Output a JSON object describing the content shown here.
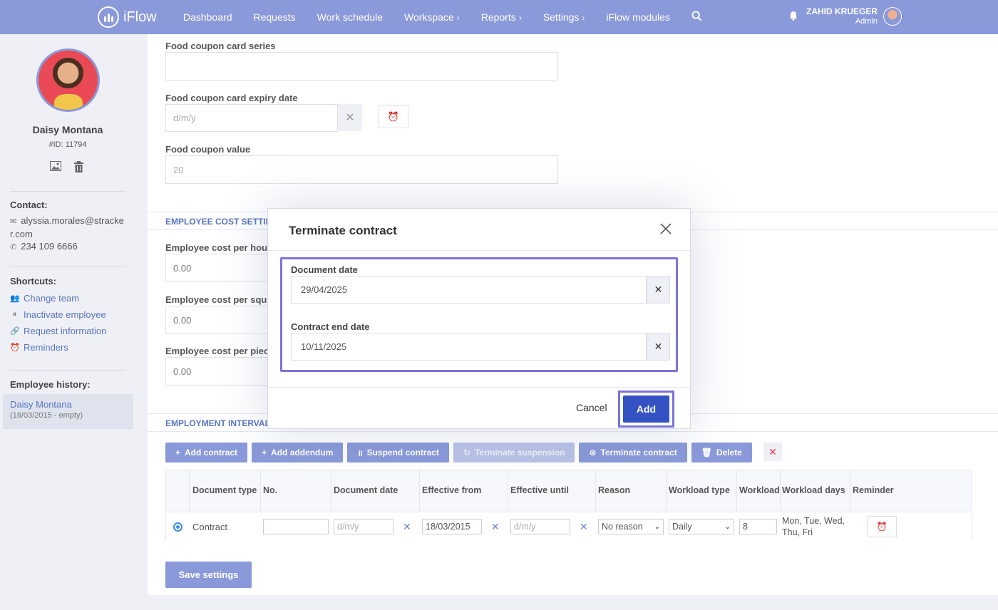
{
  "topbar": {
    "logo_text": "iFlow",
    "nav": [
      {
        "label": "Dashboard",
        "chevron": false
      },
      {
        "label": "Requests",
        "chevron": false
      },
      {
        "label": "Work schedule",
        "chevron": false
      },
      {
        "label": "Workspace",
        "chevron": true
      },
      {
        "label": "Reports",
        "chevron": true
      },
      {
        "label": "Settings",
        "chevron": true
      },
      {
        "label": "iFlow modules",
        "chevron": false
      }
    ],
    "user_name": "ZAHID KRUEGER",
    "user_role": "Admin",
    "accent": "#8a99d9"
  },
  "sidebar": {
    "name": "Daisy Montana",
    "id_text": "#ID: 11794",
    "contact_heading": "Contact:",
    "email": "alyssia.morales@stracker.com",
    "phone": "234 109 6666",
    "shortcuts_heading": "Shortcuts:",
    "shortcuts": [
      {
        "label": "Change team",
        "icon": "users-icon"
      },
      {
        "label": "Inactivate employee",
        "icon": "pause-icon"
      },
      {
        "label": "Request information",
        "icon": "link-icon"
      },
      {
        "label": "Reminders",
        "icon": "alarm-icon"
      }
    ],
    "history_heading": "Employee history:",
    "history_name": "Daisy Montana",
    "history_sub": "(18/03/2015 - empty)"
  },
  "form": {
    "card_series_label": "Food coupon card series",
    "card_series_value": "",
    "expiry_label": "Food coupon card expiry date",
    "expiry_placeholder": "d/m/y",
    "coupon_value_label": "Food coupon value",
    "coupon_value": "20",
    "cost_section": "EMPLOYEE COST SETTINGS",
    "cost_hour_label": "Employee cost per hou",
    "cost_hour_value": "0.00",
    "cost_sq_label": "Employee cost per squ",
    "cost_sq_value": "0.00",
    "cost_piece_label": "Employee cost per piec",
    "cost_piece_value": "0.00",
    "intervals_section": "EMPLOYMENT INTERVALS"
  },
  "toolbar": {
    "add_contract": "Add contract",
    "add_addendum": "Add addendum",
    "suspend_contract": "Suspend contract",
    "terminate_suspension": "Terminate suspension",
    "terminate_contract": "Terminate contract",
    "delete": "Delete"
  },
  "grid": {
    "headers": [
      "Document type",
      "No.",
      "Document date",
      "Effective from",
      "Effective until",
      "Reason",
      "Workload type",
      "Workload",
      "Workload days",
      "Reminder"
    ],
    "row": {
      "document_type": "Contract",
      "no": "",
      "document_date_placeholder": "d/m/y",
      "effective_from": "18/03/2015",
      "effective_until_placeholder": "d/m/y",
      "reason": "No reason",
      "workload_type": "Daily",
      "workload": "8",
      "workload_days_line1": "Mon, Tue, Wed,",
      "workload_days_line2": "Thu, Fri"
    }
  },
  "save_label": "Save settings",
  "modal": {
    "title": "Terminate contract",
    "document_date_label": "Document date",
    "document_date_value": "29/04/2025",
    "contract_end_label": "Contract end date",
    "contract_end_value": "10/11/2025",
    "cancel_label": "Cancel",
    "add_label": "Add"
  }
}
